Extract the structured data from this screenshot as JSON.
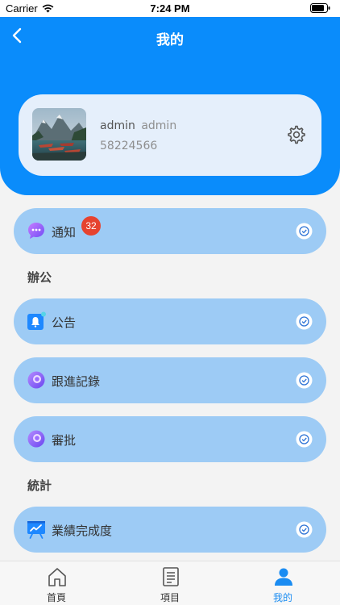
{
  "status_bar": {
    "carrier": "Carrier",
    "time": "7:24 PM"
  },
  "header": {
    "title": "我的"
  },
  "profile": {
    "name": "admin",
    "role": "admin",
    "phone": "58224566"
  },
  "menu": {
    "notice": {
      "label": "通知",
      "badge": "32"
    },
    "section_office": "辦公",
    "announcement": {
      "label": "公告"
    },
    "followup": {
      "label": "跟進記錄"
    },
    "approval": {
      "label": "審批"
    },
    "section_stats": "統計",
    "performance": {
      "label": "業績完成度"
    }
  },
  "tabs": [
    {
      "label": "首頁",
      "icon": "home-icon"
    },
    {
      "label": "項目",
      "icon": "list-icon"
    },
    {
      "label": "我的",
      "icon": "person-icon"
    }
  ],
  "colors": {
    "accent": "#0a8cfb",
    "row_bg": "#9dcbf5",
    "badge": "#e6432f",
    "tab_active": "#1a8cf2"
  }
}
